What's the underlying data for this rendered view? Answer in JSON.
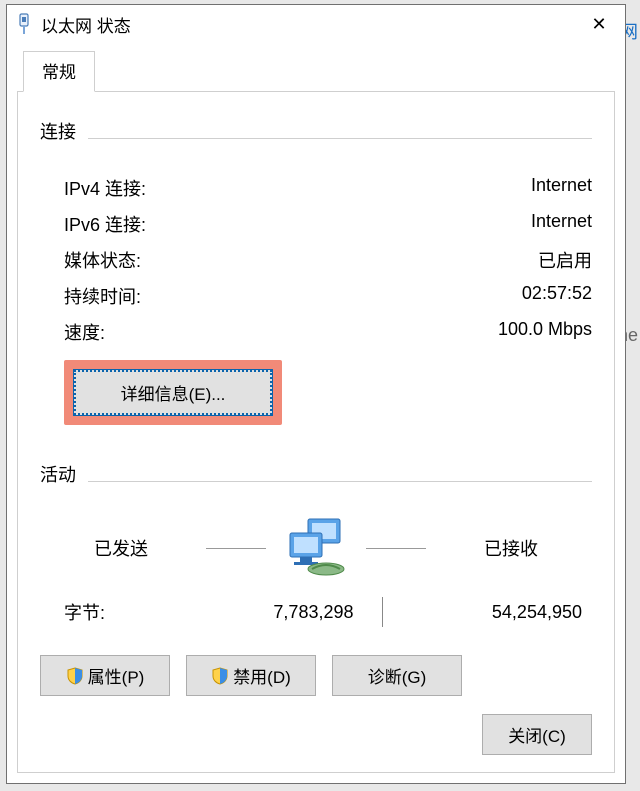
{
  "window": {
    "title": "以太网 状态",
    "close_icon": "✕"
  },
  "tabs": {
    "general": "常规"
  },
  "connection": {
    "section": "连接",
    "ipv4_label": "IPv4 连接:",
    "ipv4_value": "Internet",
    "ipv6_label": "IPv6 连接:",
    "ipv6_value": "Internet",
    "media_label": "媒体状态:",
    "media_value": "已启用",
    "duration_label": "持续时间:",
    "duration_value": "02:57:52",
    "speed_label": "速度:",
    "speed_value": "100.0 Mbps",
    "details_button": "详细信息(E)..."
  },
  "activity": {
    "section": "活动",
    "sent_label": "已发送",
    "received_label": "已接收",
    "bytes_label": "字节:",
    "bytes_sent": "7,783,298",
    "bytes_received": "54,254,950"
  },
  "buttons": {
    "properties": "属性(P)",
    "disable": "禁用(D)",
    "diagnose": "诊断(G)",
    "close": "关闭(C)"
  }
}
